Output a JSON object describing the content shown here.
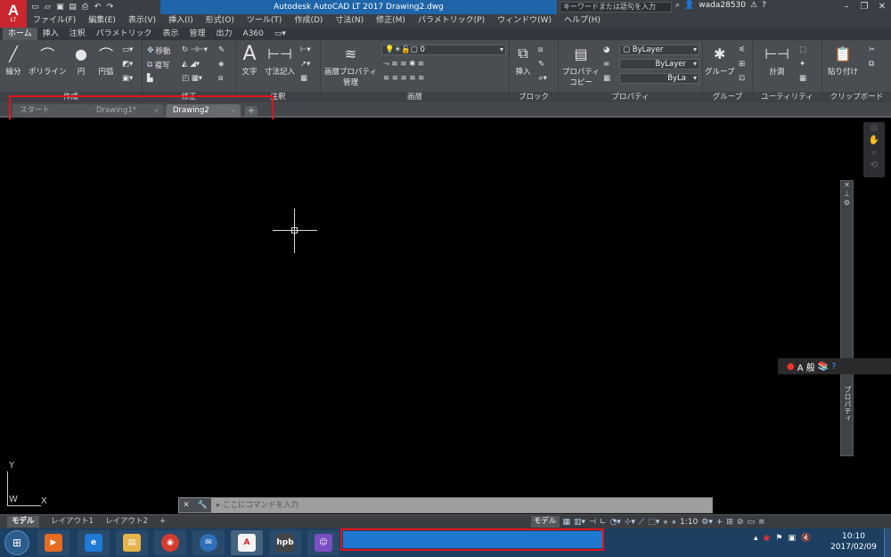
{
  "titlebar": {
    "logo": "A",
    "logo_sub": "LT",
    "title": "Autodesk AutoCAD LT 2017    Drawing2.dwg",
    "search_placeholder": "キーワードまたは語句を入力",
    "user": "wada28530"
  },
  "menu": [
    "ファイル(F)",
    "編集(E)",
    "表示(V)",
    "挿入(I)",
    "形式(O)",
    "ツール(T)",
    "作成(D)",
    "寸法(N)",
    "修正(M)",
    "パラメトリック(P)",
    "ウィンドウ(W)",
    "ヘルプ(H)"
  ],
  "ribbon_tabs": [
    "ホーム",
    "挿入",
    "注釈",
    "パラメトリック",
    "表示",
    "管理",
    "出力",
    "A360"
  ],
  "ribbon": {
    "draw": {
      "title": "作成",
      "line": "線分",
      "polyline": "ポリライン",
      "circle": "円",
      "arc": "円弧"
    },
    "modify": {
      "title": "修正",
      "move": "移動",
      "copy": "複写"
    },
    "annotation": {
      "title": "注釈",
      "text": "文字",
      "dimension": "寸法記入"
    },
    "layers": {
      "title": "画層",
      "layer_props": "画層プロパティ",
      "layer_props_2": "管理",
      "current_layer": "0"
    },
    "block": {
      "title": "ブロック",
      "insert": "挿入"
    },
    "properties": {
      "title": "プロパティ",
      "match": "プロパティ",
      "match_2": "コピー",
      "color": "ByLayer",
      "linetype": "ByLayer",
      "lineweight": "ByLa"
    },
    "groups": {
      "title": "グループ",
      "group": "グループ"
    },
    "utilities": {
      "title": "ユーティリティ",
      "measure": "計測"
    },
    "clipboard": {
      "title": "クリップボード",
      "paste": "貼り付け"
    }
  },
  "file_tabs": [
    {
      "label": "スタート"
    },
    {
      "label": "Drawing1*"
    },
    {
      "label": "Drawing2"
    }
  ],
  "canvas": {
    "ucs_y": "Y",
    "ucs_x": "X",
    "ucs_w": "W",
    "palette_title": "プロパティ",
    "ime_text": "A 般",
    "command_placeholder": "ここにコマンドを入力"
  },
  "layout_tabs": [
    "モデル",
    "レイアウト1",
    "レイアウト2"
  ],
  "status": {
    "model": "モデル",
    "scale": "1:10"
  },
  "taskbar": {
    "time": "10:10",
    "date": "2017/02/09"
  }
}
